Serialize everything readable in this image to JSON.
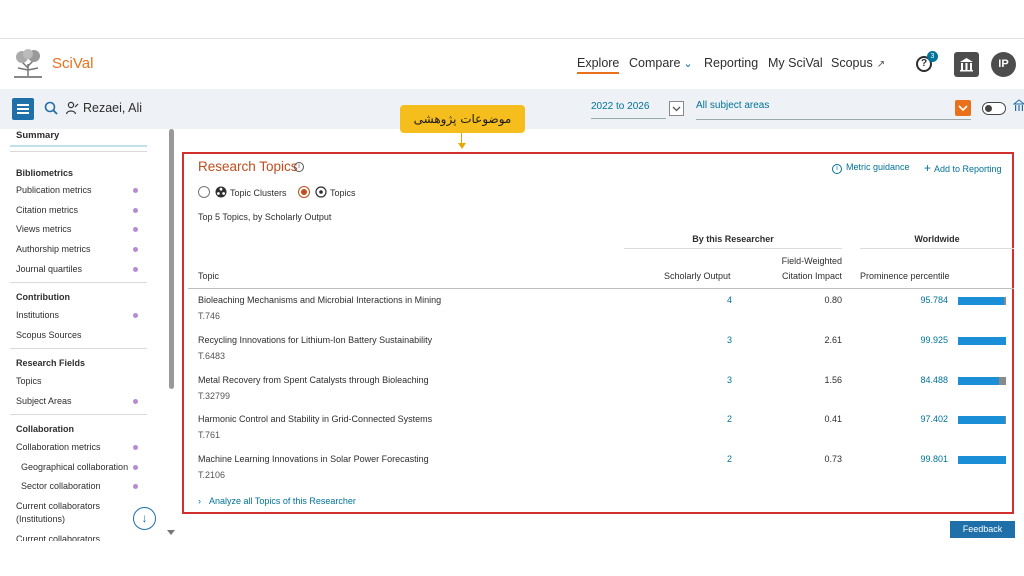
{
  "header": {
    "brand": "SciVal",
    "nav": [
      "Explore",
      "Compare",
      "Reporting",
      "My SciVal",
      "Scopus"
    ],
    "help_badge": "3",
    "avatar_initials": "IP"
  },
  "subbar": {
    "researcher_name": "Rezaei, Ali",
    "year_range": "2022 to 2026",
    "subject_areas": "All subject areas"
  },
  "annotation": "موضوعات پژوهشی",
  "sidebar": {
    "summary": "Summary",
    "sections": [
      {
        "title": "Bibliometrics",
        "items": [
          {
            "label": "Publication metrics",
            "dot": true
          },
          {
            "label": "Citation metrics",
            "dot": true
          },
          {
            "label": "Views metrics",
            "dot": true
          },
          {
            "label": "Authorship metrics",
            "dot": true
          },
          {
            "label": "Journal quartiles",
            "dot": true
          }
        ]
      },
      {
        "title": "Contribution",
        "items": [
          {
            "label": "Institutions",
            "dot": true
          },
          {
            "label": "Scopus Sources",
            "dot": false
          }
        ]
      },
      {
        "title": "Research Fields",
        "items": [
          {
            "label": "Topics",
            "dot": false
          },
          {
            "label": "Subject Areas",
            "dot": true
          }
        ]
      },
      {
        "title": "Collaboration",
        "items": [
          {
            "label": "Collaboration metrics",
            "dot": true
          },
          {
            "label": "Geographical collaboration",
            "dot": true
          },
          {
            "label": "Sector collaboration",
            "dot": true
          },
          {
            "label": "Current collaborators (Institutions)",
            "dot": false
          },
          {
            "label": "Current collaborators",
            "dot": false
          }
        ]
      }
    ]
  },
  "panel": {
    "title": "Research Topics",
    "metric_guidance": "Metric guidance",
    "add_to_reporting": "Add to Reporting",
    "radio_clusters": "Topic Clusters",
    "radio_topics": "Topics",
    "subtitle": "Top 5 Topics, by Scholarly Output",
    "group_researcher": "By this Researcher",
    "group_worldwide": "Worldwide",
    "col_topic": "Topic",
    "col_scholarly": "Scholarly Output",
    "col_fwci_1": "Field-Weighted",
    "col_fwci_2": "Citation Impact",
    "col_prominence": "Prominence percentile",
    "rows": [
      {
        "name": "Bioleaching Mechanisms and Microbial Interactions in Mining",
        "code": "T.746",
        "scholarly_output": "4",
        "fwci": "0.80",
        "prominence": "95.784",
        "bar_fraction": 0.95784
      },
      {
        "name": "Recycling Innovations for Lithium-Ion Battery Sustainability",
        "code": "T.6483",
        "scholarly_output": "3",
        "fwci": "2.61",
        "prominence": "99.925",
        "bar_fraction": 0.99925
      },
      {
        "name": "Metal Recovery from Spent Catalysts through Bioleaching",
        "code": "T.32799",
        "scholarly_output": "3",
        "fwci": "1.56",
        "prominence": "84.488",
        "bar_fraction": 0.84488
      },
      {
        "name": "Harmonic Control and Stability in Grid-Connected Systems",
        "code": "T.761",
        "scholarly_output": "2",
        "fwci": "0.41",
        "prominence": "97.402",
        "bar_fraction": 0.97402
      },
      {
        "name": "Machine Learning Innovations in Solar Power Forecasting",
        "code": "T.2106",
        "scholarly_output": "2",
        "fwci": "0.73",
        "prominence": "99.801",
        "bar_fraction": 0.99801
      }
    ],
    "analyze_link": "Analyze all Topics of this Researcher"
  },
  "feedback": "Feedback",
  "colors": {
    "accent": "#e9711c",
    "link": "#007398",
    "frame": "#d32f2f",
    "bar": "#1a8fd8"
  }
}
